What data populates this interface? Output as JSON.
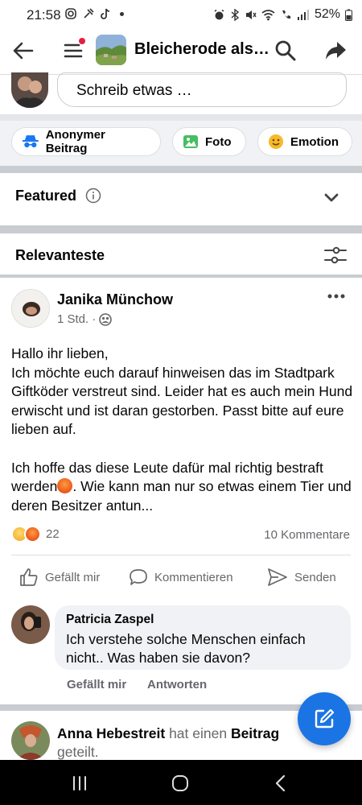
{
  "status_bar": {
    "time": "21:58",
    "battery": "52%"
  },
  "header": {
    "group_title": "Bleicherode als…",
    "notification_dot_color": "#e41e3f"
  },
  "composer": {
    "placeholder": "Schreib etwas …"
  },
  "chips": [
    {
      "label": "Anonymer Beitrag",
      "icon": "anonymous-icon"
    },
    {
      "label": "Foto",
      "icon": "photo-icon"
    },
    {
      "label": "Emotion",
      "icon": "emotion-icon"
    }
  ],
  "featured": {
    "label": "Featured"
  },
  "sort": {
    "label": "Relevanteste"
  },
  "post": {
    "author": "Janika Münchow",
    "time": "1 Std. ·",
    "audience_icon": "group-members-icon",
    "text_part1": "Hallo ihr lieben,\nIch möchte euch darauf hinweisen das im Stadtpark Giftköder verstreut sind. Leider hat es auch mein Hund erwischt und ist daran gestorben. Passt bitte auf eure lieben auf.\n\nIch hoffe das diese Leute dafür mal richtig bestraft werden",
    "text_part2": ".  Wie kann man nur so etwas einem Tier und deren Besitzer antun...",
    "reaction_count": "22",
    "comment_count": "10 Kommentare",
    "actions": {
      "like": "Gefällt mir",
      "comment": "Kommentieren",
      "share": "Senden"
    }
  },
  "comment": {
    "author": "Patricia Zaspel",
    "text": "Ich verstehe solche Menschen einfach nicht.. Was haben sie davon?",
    "like": "Gefällt mir",
    "reply": "Antworten"
  },
  "next_post": {
    "author": "Anna Hebestreit",
    "verb": " hat einen ",
    "object": "Beitrag",
    "suffix": "geteilt."
  },
  "colors": {
    "accent": "#1b74e4",
    "muted": "#65676b",
    "divider": "#c9ccd1"
  }
}
